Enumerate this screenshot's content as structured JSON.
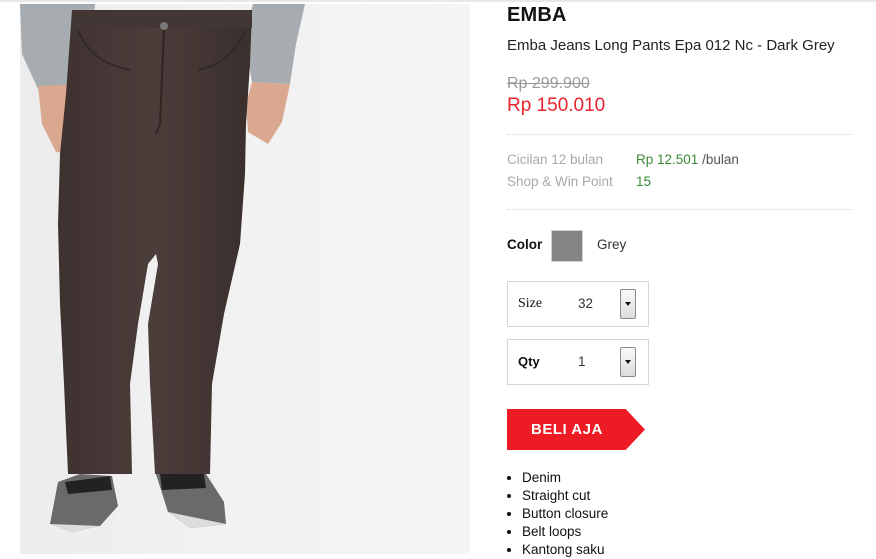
{
  "product": {
    "brand": "EMBA",
    "title": "Emba Jeans Long Pants Epa 012 Nc - Dark Grey",
    "image_alt": "product-photo",
    "old_price": "Rp 299.900",
    "new_price": "Rp 150.010"
  },
  "installment": {
    "label": "Cicilan 12 bulan",
    "value": "Rp 12.501",
    "unit": "/bulan"
  },
  "points": {
    "label": "Shop & Win Point",
    "value": "15"
  },
  "color": {
    "label": "Color",
    "swatch_hex": "#858585",
    "name": "Grey"
  },
  "size": {
    "label": "Size",
    "selected": "32"
  },
  "qty": {
    "label": "Qty",
    "selected": "1"
  },
  "buy_button": {
    "label": "BELI AJA",
    "color": "#ed1c24"
  },
  "features": [
    "Denim",
    "Straight cut",
    "Button closure",
    "Belt loops",
    "Kantong saku"
  ],
  "icons": {
    "dropdown": "chevron-down-icon"
  }
}
